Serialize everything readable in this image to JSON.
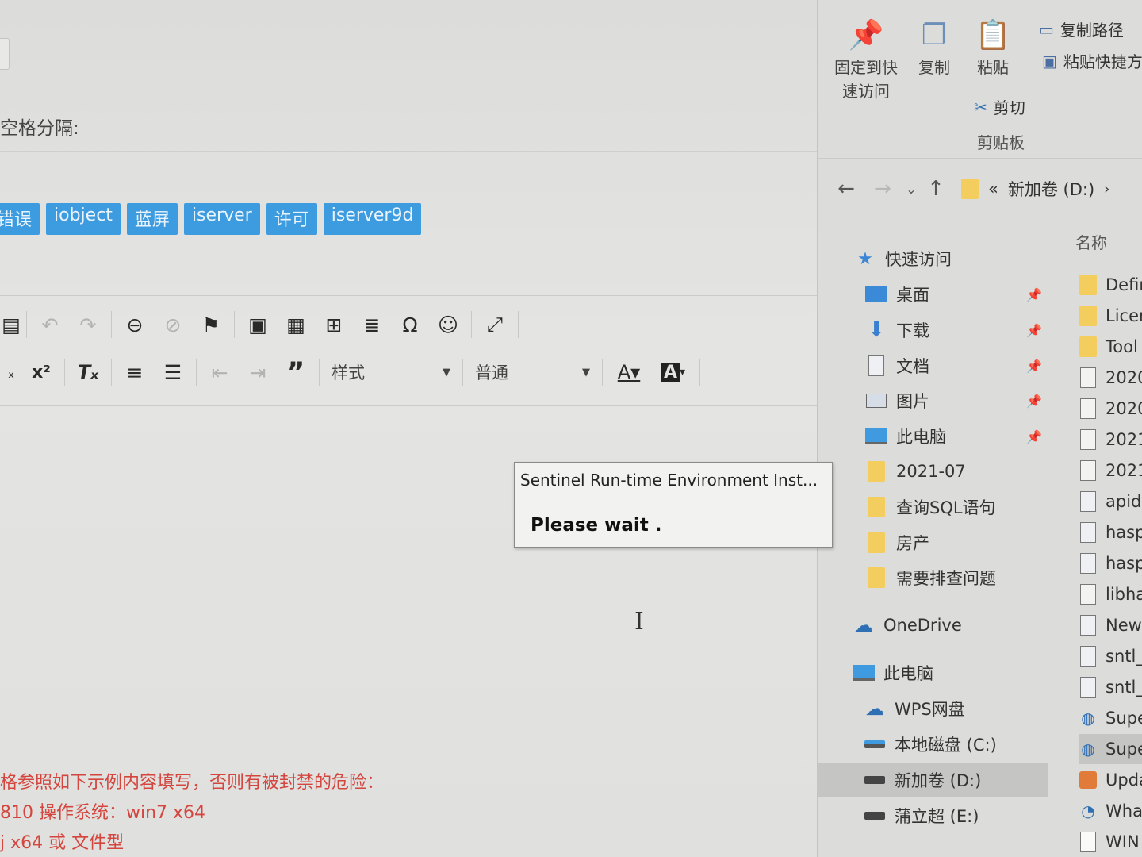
{
  "editor": {
    "tags_label": "空格分隔:",
    "tags": [
      "错误",
      "iobject",
      "蓝屏",
      "iserver",
      "许可",
      "iserver9d"
    ],
    "toolbar": {
      "style_select": "样式",
      "format_select": "普通"
    },
    "notes": [
      "格参照如下示例内容填写，否则有被封禁的危险：",
      "810 操作系统：win7 x64",
      "j x64 或 文件型"
    ]
  },
  "dialog": {
    "title": "Sentinel Run-time Environment Inst...",
    "message": "Please wait ."
  },
  "explorer": {
    "ribbon": {
      "pin_label": "固定到快\n速访问",
      "copy_label": "复制",
      "paste_label": "粘贴",
      "copy_path_label": "复制路径",
      "paste_shortcut_label": "粘贴快捷方",
      "cut_label": "剪切",
      "group_label": "剪贴板"
    },
    "address": {
      "prefix": "«",
      "path": "新加卷 (D:)",
      "sep": "›"
    },
    "nav": [
      {
        "label": "快速访问",
        "icon": "star-icon"
      },
      {
        "label": "桌面",
        "icon": "desktop-icon",
        "pinned": true
      },
      {
        "label": "下载",
        "icon": "download-icon",
        "pinned": true
      },
      {
        "label": "文档",
        "icon": "document-icon",
        "pinned": true
      },
      {
        "label": "图片",
        "icon": "picture-icon",
        "pinned": true
      },
      {
        "label": "此电脑",
        "icon": "computer-icon",
        "pinned": true
      },
      {
        "label": "2021-07",
        "icon": "folder-icon"
      },
      {
        "label": "查询SQL语句",
        "icon": "folder-icon"
      },
      {
        "label": "房产",
        "icon": "folder-icon"
      },
      {
        "label": "需要排查问题",
        "icon": "folder-icon"
      },
      {
        "label": "OneDrive",
        "icon": "cloud-icon"
      },
      {
        "label": "此电脑",
        "icon": "computer-icon"
      },
      {
        "label": "WPS网盘",
        "icon": "cloud-icon"
      },
      {
        "label": "本地磁盘 (C:)",
        "icon": "drive-icon"
      },
      {
        "label": "新加卷 (D:)",
        "icon": "drive-icon",
        "selected": true
      },
      {
        "label": "蒲立超 (E:)",
        "icon": "drive-icon"
      }
    ],
    "column_name": "名称",
    "files": [
      {
        "name": "Defir",
        "type": "folder"
      },
      {
        "name": "Licer",
        "type": "folder"
      },
      {
        "name": "Tool",
        "type": "folder"
      },
      {
        "name": "2020",
        "type": "doc"
      },
      {
        "name": "2020",
        "type": "doc"
      },
      {
        "name": "2021",
        "type": "doc"
      },
      {
        "name": "2021",
        "type": "doc"
      },
      {
        "name": "apid",
        "type": "cfg"
      },
      {
        "name": "hasp",
        "type": "cfg"
      },
      {
        "name": "hasp",
        "type": "cfg"
      },
      {
        "name": "libha",
        "type": "doc"
      },
      {
        "name": "New",
        "type": "cfg"
      },
      {
        "name": "sntl_",
        "type": "cfg"
      },
      {
        "name": "sntl_",
        "type": "cfg"
      },
      {
        "name": "Supe",
        "type": "app"
      },
      {
        "name": "Supe",
        "type": "app",
        "selected": true
      },
      {
        "name": "Upda",
        "type": "upd"
      },
      {
        "name": "Wha",
        "type": "app"
      },
      {
        "name": "WIN",
        "type": "doc"
      }
    ]
  }
}
